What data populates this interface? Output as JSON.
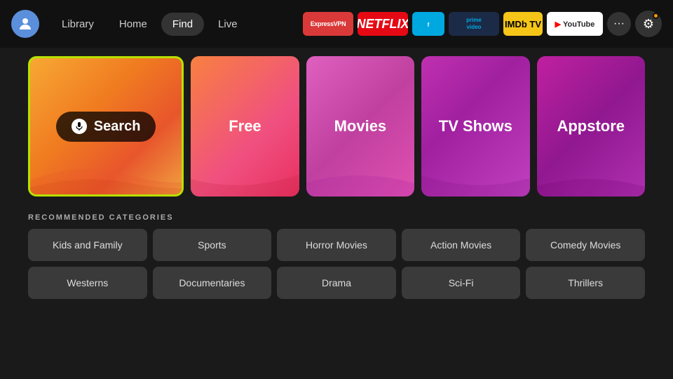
{
  "header": {
    "nav_items": [
      {
        "label": "Library",
        "active": false
      },
      {
        "label": "Home",
        "active": false
      },
      {
        "label": "Find",
        "active": true
      },
      {
        "label": "Live",
        "active": false
      }
    ],
    "apps": [
      {
        "name": "ExpressVPN",
        "key": "expressvpn"
      },
      {
        "name": "NETFLIX",
        "key": "netflix"
      },
      {
        "name": "Freevee",
        "key": "freevee"
      },
      {
        "name": "prime video",
        "key": "prime"
      },
      {
        "name": "IMDb TV",
        "key": "imdb"
      },
      {
        "name": "▶ YouTube",
        "key": "youtube"
      }
    ],
    "more_label": "···",
    "settings_label": "⚙"
  },
  "tiles": [
    {
      "key": "search",
      "label": "Search",
      "type": "search"
    },
    {
      "key": "free",
      "label": "Free",
      "type": "tile"
    },
    {
      "key": "movies",
      "label": "Movies",
      "type": "tile"
    },
    {
      "key": "tvshows",
      "label": "TV Shows",
      "type": "tile"
    },
    {
      "key": "appstore",
      "label": "Appstore",
      "type": "tile"
    }
  ],
  "recommended": {
    "title": "RECOMMENDED CATEGORIES",
    "rows": [
      [
        "Kids and Family",
        "Sports",
        "Horror Movies",
        "Action Movies",
        "Comedy Movies"
      ],
      [
        "Westerns",
        "Documentaries",
        "Drama",
        "Sci-Fi",
        "Thrillers"
      ]
    ]
  }
}
